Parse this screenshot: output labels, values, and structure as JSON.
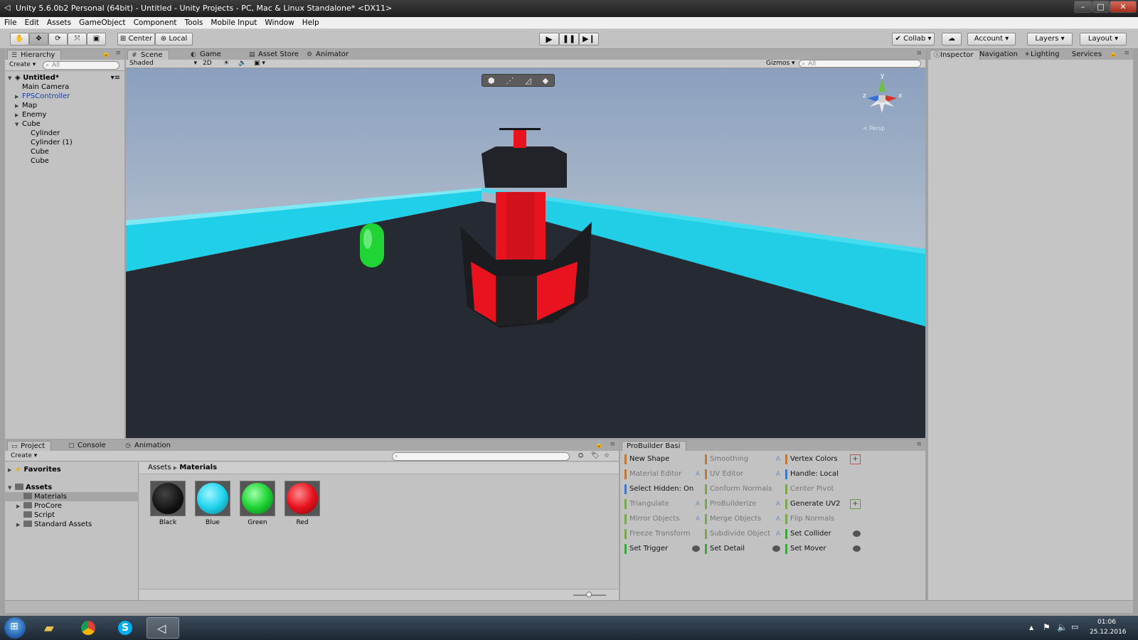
{
  "window": {
    "title": "Unity 5.6.0b2 Personal (64bit) - Untitled - Unity Projects - PC, Mac & Linux Standalone* <DX11>",
    "minimize": "–",
    "maximize": "□",
    "close": "✕"
  },
  "menu": [
    "File",
    "Edit",
    "Assets",
    "GameObject",
    "Component",
    "Tools",
    "Mobile Input",
    "Window",
    "Help"
  ],
  "toolbar": {
    "pivot": "Center",
    "space": "Local",
    "collab": "Collab",
    "account": "Account",
    "layers": "Layers",
    "layout": "Layout"
  },
  "hierarchy": {
    "tab": "Hierarchy",
    "create": "Create",
    "search_placeholder": "All",
    "scene_name": "Untitled*",
    "items": [
      "Main Camera",
      "FPSController",
      "Map",
      "Enemy",
      "Cube",
      "Cylinder",
      "Cylinder (1)",
      "Cube",
      "Cube"
    ]
  },
  "scene": {
    "tabs": [
      "Scene",
      "Game",
      "Asset Store",
      "Animator"
    ],
    "shading": "Shaded",
    "mode_2d": "2D",
    "gizmos": "Gizmos",
    "search_placeholder": "All",
    "persp": "< Persp",
    "axis_y": "y",
    "axis_x": "x",
    "axis_z": "z"
  },
  "inspector": {
    "tabs": [
      "Inspector",
      "Navigation",
      "Lighting",
      "Services"
    ]
  },
  "project": {
    "tabs": [
      "Project",
      "Console",
      "Animation"
    ],
    "create": "Create",
    "favorites": "Favorites",
    "assets": "Assets",
    "folders": [
      "Materials",
      "ProCore",
      "Script",
      "Standard Assets"
    ],
    "breadcrumb": [
      "Assets",
      "Materials"
    ],
    "materials": [
      {
        "name": "Black",
        "color": "#1a1a1a"
      },
      {
        "name": "Blue",
        "color": "#22d4ee"
      },
      {
        "name": "Green",
        "color": "#1fd434"
      },
      {
        "name": "Red",
        "color": "#e8131f"
      }
    ]
  },
  "probuilder": {
    "tab": "ProBuilder Basi",
    "option_glyph": "A",
    "plus_glyph": "+",
    "col1": [
      {
        "label": "New Shape",
        "color": "#c0773a",
        "dim": false,
        "extra": ""
      },
      {
        "label": "Material Editor",
        "color": "#c0773a",
        "dim": true,
        "extra": "opt"
      },
      {
        "label": "Select Hidden: On",
        "color": "#3e78c0",
        "dim": false,
        "extra": ""
      },
      {
        "label": "Triangulate",
        "color": "#78a84a",
        "dim": true,
        "extra": "opt"
      },
      {
        "label": "Mirror Objects",
        "color": "#78a84a",
        "dim": true,
        "extra": "opt"
      },
      {
        "label": "Freeze Transform",
        "color": "#78a84a",
        "dim": true,
        "extra": ""
      },
      {
        "label": "Set Trigger",
        "color": "#3ca83c",
        "dim": false,
        "extra": "eye"
      }
    ],
    "col2": [
      {
        "label": "Smoothing",
        "color": "#c0773a",
        "dim": true,
        "extra": "opt"
      },
      {
        "label": "UV Editor",
        "color": "#c0773a",
        "dim": true,
        "extra": "opt"
      },
      {
        "label": "Conform Normals",
        "color": "#78a84a",
        "dim": true,
        "extra": ""
      },
      {
        "label": "ProBuilderize",
        "color": "#78a84a",
        "dim": true,
        "extra": "opt"
      },
      {
        "label": "Merge Objects",
        "color": "#78a84a",
        "dim": true,
        "extra": "opt"
      },
      {
        "label": "Subdivide Object",
        "color": "#78a84a",
        "dim": true,
        "extra": "opt"
      },
      {
        "label": "Set Detail",
        "color": "#3ca83c",
        "dim": false,
        "extra": "eye"
      }
    ],
    "col3": [
      {
        "label": "Vertex Colors",
        "color": "#c0773a",
        "dim": false,
        "extra": "plus"
      },
      {
        "label": "Handle: Local",
        "color": "#3e78c0",
        "dim": false,
        "extra": ""
      },
      {
        "label": "Center Pivot",
        "color": "#78a84a",
        "dim": true,
        "extra": ""
      },
      {
        "label": "Generate UV2",
        "color": "#78a84a",
        "dim": false,
        "extra": "plusg"
      },
      {
        "label": "Flip Normals",
        "color": "#78a84a",
        "dim": true,
        "extra": ""
      },
      {
        "label": "Set Collider",
        "color": "#3ca83c",
        "dim": false,
        "extra": "eye"
      },
      {
        "label": "Set Mover",
        "color": "#3ca83c",
        "dim": false,
        "extra": "eye"
      }
    ]
  },
  "taskbar": {
    "time": "01:06",
    "date": "25.12.2016",
    "tray_up": "▲"
  }
}
